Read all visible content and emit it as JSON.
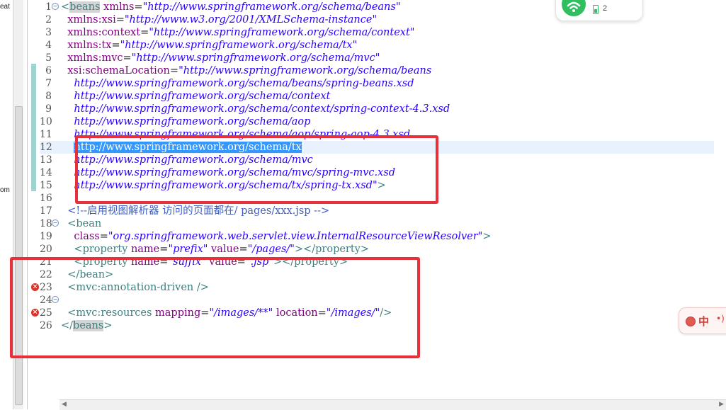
{
  "left_panel": {
    "cut_labels": [
      "eat",
      "om"
    ]
  },
  "editor": {
    "lines": [
      {
        "num": "1",
        "fold": "−",
        "segments": [
          [
            "tag",
            "<"
          ],
          [
            "hl-tag",
            "beans"
          ],
          [
            "attr",
            " xmlns"
          ],
          [
            "plain",
            "="
          ],
          [
            "str",
            "\"http://www.springframework.org/schema/beans\""
          ]
        ]
      },
      {
        "num": "2",
        "segments": [
          [
            "attr",
            "  xmlns:xsi"
          ],
          [
            "plain",
            "="
          ],
          [
            "str",
            "\"http://www.w3.org/2001/XMLSchema-instance\""
          ]
        ]
      },
      {
        "num": "3",
        "segments": [
          [
            "attr",
            "  xmlns:context"
          ],
          [
            "plain",
            "="
          ],
          [
            "str",
            "\"http://www.springframework.org/schema/context\""
          ]
        ]
      },
      {
        "num": "4",
        "segments": [
          [
            "attr",
            "  xmlns:tx"
          ],
          [
            "plain",
            "="
          ],
          [
            "str",
            "\"http://www.springframework.org/schema/tx\""
          ]
        ]
      },
      {
        "num": "5",
        "segments": [
          [
            "attr",
            "  xmlns:mvc"
          ],
          [
            "plain",
            "="
          ],
          [
            "str",
            "\"http://www.springframework.org/schema/mvc\""
          ]
        ]
      },
      {
        "num": "6",
        "segments": [
          [
            "attr",
            "  xsi:schemaLocation"
          ],
          [
            "plain",
            "="
          ],
          [
            "str",
            "\"http://www.springframework.org/schema/beans"
          ]
        ]
      },
      {
        "num": "7",
        "segments": [
          [
            "str",
            "    http://www.springframework.org/schema/beans/spring-beans.xsd"
          ]
        ]
      },
      {
        "num": "8",
        "segments": [
          [
            "str",
            "    http://www.springframework.org/schema/context"
          ]
        ]
      },
      {
        "num": "9",
        "segments": [
          [
            "str",
            "    http://www.springframework.org/schema/context/spring-context-4.3.xsd"
          ]
        ]
      },
      {
        "num": "10",
        "segments": [
          [
            "str",
            "    http://www.springframework.org/schema/aop"
          ]
        ]
      },
      {
        "num": "11",
        "segments": [
          [
            "str",
            "    http://www.springframework.org/schema/aop/spring-aop-4.3.xsd"
          ]
        ]
      },
      {
        "num": "12",
        "current": true,
        "segments": [
          [
            "plain",
            "    "
          ],
          [
            "sel",
            "http://www.springframework.org/schema/tx"
          ]
        ]
      },
      {
        "num": "13",
        "segments": [
          [
            "str",
            "    http://www.springframework.org/schema/mvc"
          ]
        ]
      },
      {
        "num": "14",
        "segments": [
          [
            "str",
            "    http://www.springframework.org/schema/mvc/spring-mvc.xsd"
          ]
        ]
      },
      {
        "num": "15",
        "segments": [
          [
            "str",
            "    http://www.springframework.org/schema/tx/spring-tx.xsd\""
          ],
          [
            "tag",
            ">"
          ]
        ]
      },
      {
        "num": "16",
        "segments": []
      },
      {
        "num": "17",
        "segments": [
          [
            "cmt",
            "  <!--启用视图解析器 访问的页面都在/ pages/xxx.jsp -->"
          ]
        ]
      },
      {
        "num": "18",
        "fold": "−",
        "segments": [
          [
            "tag",
            "  <bean"
          ]
        ]
      },
      {
        "num": "19",
        "segments": [
          [
            "attr",
            "    class"
          ],
          [
            "plain",
            "="
          ],
          [
            "str",
            "\"org.springframework.web.servlet.view.InternalResourceViewResolver\""
          ],
          [
            "tag",
            ">"
          ]
        ]
      },
      {
        "num": "20",
        "segments": [
          [
            "tag",
            "    <property"
          ],
          [
            "attr",
            " name"
          ],
          [
            "plain",
            "="
          ],
          [
            "str",
            "\"prefix\""
          ],
          [
            "attr",
            " value"
          ],
          [
            "plain",
            "="
          ],
          [
            "str",
            "\"/pages/\""
          ],
          [
            "tag",
            "></property>"
          ]
        ]
      },
      {
        "num": "21",
        "segments": [
          [
            "tag",
            "    <property"
          ],
          [
            "attr",
            " name"
          ],
          [
            "plain",
            "="
          ],
          [
            "str",
            "\"suffix\""
          ],
          [
            "attr",
            " value"
          ],
          [
            "plain",
            "="
          ],
          [
            "str",
            "\".jsp\""
          ],
          [
            "tag",
            "></property>"
          ]
        ]
      },
      {
        "num": "22",
        "segments": [
          [
            "tag",
            "  </bean>"
          ]
        ]
      },
      {
        "num": "23",
        "error": true,
        "segments": [
          [
            "tag",
            "  <mvc:annotation-driven />"
          ]
        ]
      },
      {
        "num": "24",
        "fold": "−",
        "segments": []
      },
      {
        "num": "25",
        "error": true,
        "segments": [
          [
            "tag",
            "  <mvc:resources"
          ],
          [
            "attr",
            " mapping"
          ],
          [
            "plain",
            "="
          ],
          [
            "str",
            "\"/images/**\""
          ],
          [
            "attr",
            " location"
          ],
          [
            "plain",
            "="
          ],
          [
            "str",
            "\"/images/\""
          ],
          [
            "tag",
            "/>"
          ]
        ]
      },
      {
        "num": "26",
        "segments": [
          [
            "tag",
            "</"
          ],
          [
            "hl-tag",
            "beans"
          ],
          [
            "tag",
            ">"
          ]
        ]
      }
    ]
  },
  "wifi_widget": {
    "icon": "wifi-icon",
    "battery_icon": "battery-icon",
    "count": "2",
    "accent": "#2fbf5f"
  },
  "ime_widget": {
    "icon": "ime-dot-icon",
    "label": "中",
    "extra": "•)"
  },
  "colors": {
    "annotation_red": "#e8303a",
    "selection": "#3399ff",
    "current_line": "#e8f2fe"
  }
}
